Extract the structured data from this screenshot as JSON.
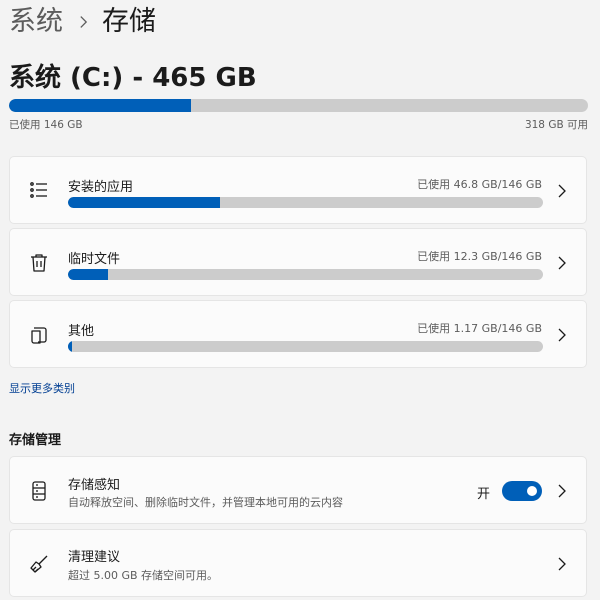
{
  "breadcrumb": {
    "parent": "系统",
    "current": "存储"
  },
  "drive": {
    "title": "系统 (C:) - 465 GB",
    "used_label": "已使用 146 GB",
    "free_label": "318 GB 可用",
    "used_fraction": 0.314
  },
  "categories": [
    {
      "icon": "apps-list-icon",
      "label": "安装的应用",
      "usage": "已使用 46.8 GB/146 GB",
      "fraction": 0.32
    },
    {
      "icon": "trash-icon",
      "label": "临时文件",
      "usage": "已使用 12.3 GB/146 GB",
      "fraction": 0.084
    },
    {
      "icon": "document-other-icon",
      "label": "其他",
      "usage": "已使用 1.17 GB/146 GB",
      "fraction": 0.008
    }
  ],
  "show_more_label": "显示更多类别",
  "management": {
    "heading": "存储管理",
    "storage_sense": {
      "icon": "storage-drive-icon",
      "title": "存储感知",
      "subtitle": "自动释放空间、删除临时文件，并管理本地可用的云内容",
      "toggle_label": "开",
      "enabled": true
    },
    "cleanup": {
      "icon": "broom-icon",
      "title": "清理建议",
      "subtitle": "超过 5.00 GB 存储空间可用。"
    }
  },
  "colors": {
    "accent": "#005fb8",
    "track": "#cccccc",
    "link": "#003e92"
  }
}
